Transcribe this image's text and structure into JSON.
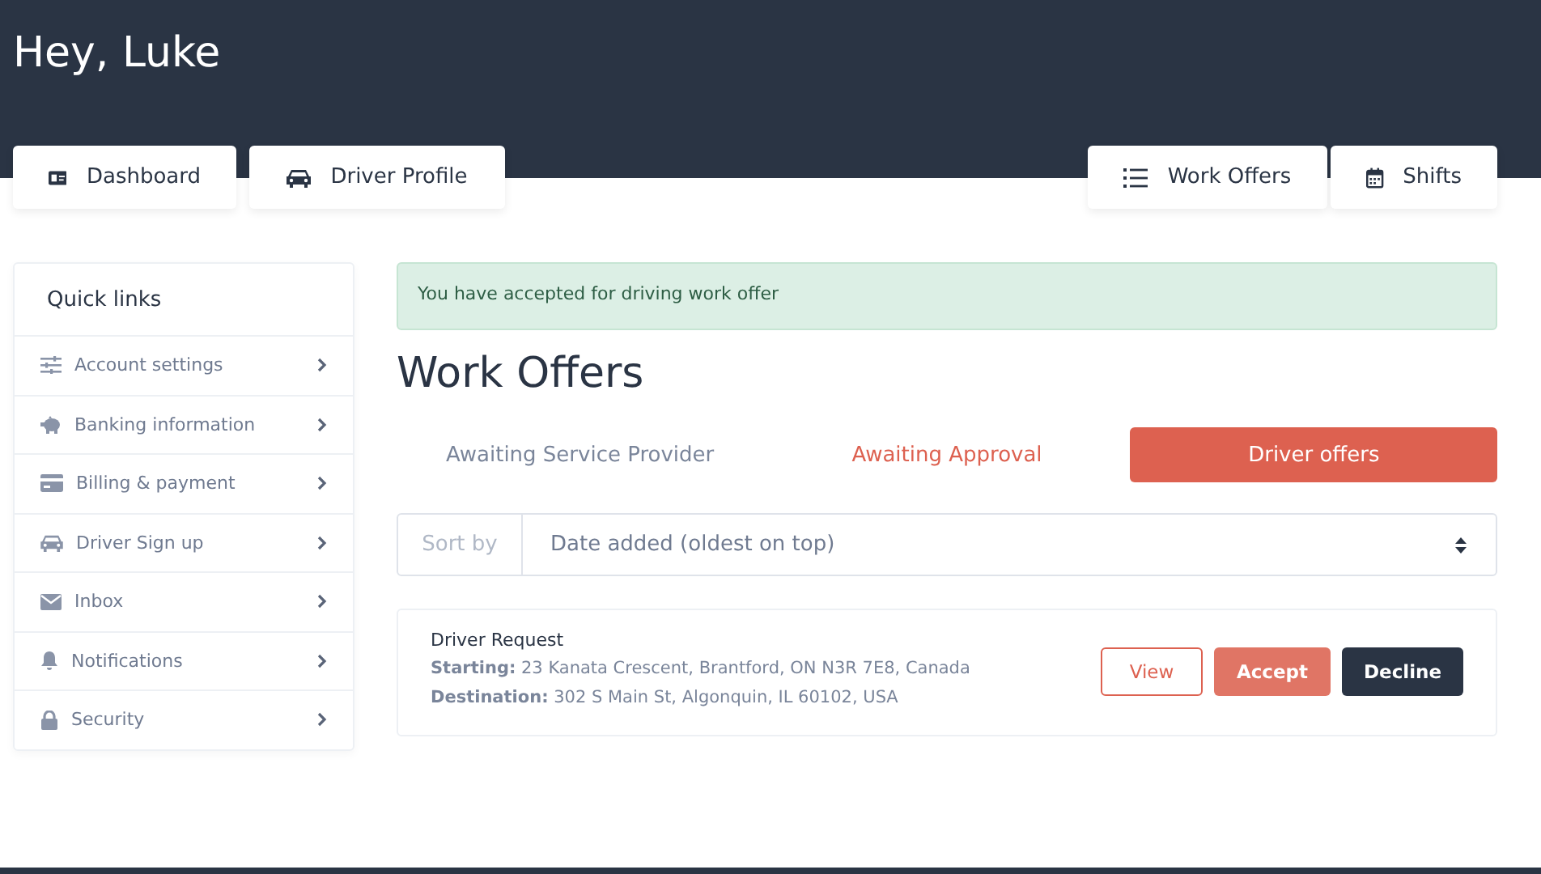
{
  "header": {
    "greeting": "Hey, Luke"
  },
  "nav_left": [
    {
      "label": "Dashboard"
    },
    {
      "label": "Driver Profile"
    }
  ],
  "nav_right": [
    {
      "label": "Work Offers"
    },
    {
      "label": "Shifts"
    }
  ],
  "sidebar": {
    "title": "Quick links",
    "items": [
      {
        "label": "Account settings"
      },
      {
        "label": "Banking information"
      },
      {
        "label": "Billing & payment"
      },
      {
        "label": "Driver Sign up"
      },
      {
        "label": "Inbox"
      },
      {
        "label": "Notifications"
      },
      {
        "label": "Security"
      }
    ]
  },
  "alert": "You have accepted for driving work offer",
  "heading": "Work Offers",
  "tabs": [
    {
      "label": "Awaiting Service Provider",
      "selected": false,
      "highlighted": false
    },
    {
      "label": "Awaiting Approval",
      "selected": false,
      "highlighted": true
    },
    {
      "label": "Driver offers",
      "selected": true,
      "highlighted": false
    }
  ],
  "sort": {
    "label": "Sort by",
    "value": "Date added (oldest on top)"
  },
  "offers": [
    {
      "title": "Driver Request",
      "starting": "**Starting:** 23 Kanata Crescent, Brantford, ON N3R 7E8, Canada",
      "destination": "**Destination:** 302 S Main St, Algonquin, IL 60102, USA",
      "buttons": [
        {
          "label": "View",
          "kind": "outline"
        },
        {
          "label": "Accept",
          "kind": "primary"
        },
        {
          "label": "Decline",
          "kind": "dark"
        }
      ]
    }
  ]
}
